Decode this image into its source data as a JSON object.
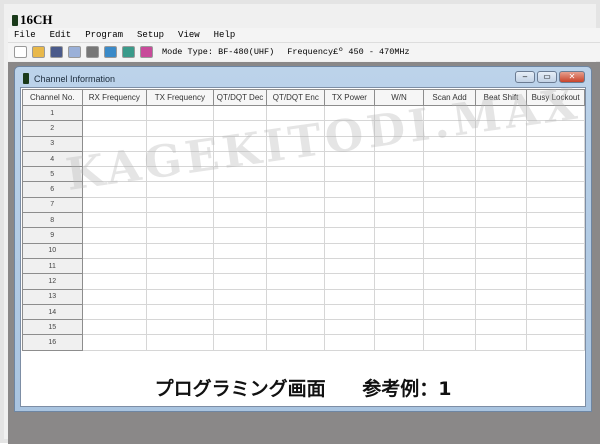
{
  "app": {
    "title": "16CH"
  },
  "menu": [
    "File",
    "Edit",
    "Program",
    "Setup",
    "View",
    "Help"
  ],
  "toolbar": {
    "icons": [
      "new-icon",
      "open-icon",
      "save-icon",
      "edit-icon",
      "print-icon",
      "read-icon",
      "write-icon",
      "eraser-icon"
    ],
    "mode_text": "Mode Type: BF-480(UHF)",
    "freq_text": "Frequency£º 450 - 470MHz"
  },
  "child": {
    "title": "Channel Information",
    "buttons": {
      "minimize": "–",
      "maximize": "▭",
      "close": "✕"
    }
  },
  "table": {
    "headers": [
      "Channel No.",
      "RX Frequency",
      "TX Frequency",
      "QT/DQT Dec",
      "QT/DQT Enc",
      "TX Power",
      "W/N",
      "Scan Add",
      "Beat Shift",
      "Busy Lockout"
    ],
    "rows": [
      "1",
      "2",
      "3",
      "4",
      "5",
      "6",
      "7",
      "8",
      "9",
      "10",
      "11",
      "12",
      "13",
      "14",
      "15",
      "16"
    ]
  },
  "caption": "プログラミング画面 参考例：1",
  "watermark": "KAGEKITODI.MAX",
  "colors": {
    "mdi_bg": "#8a8888",
    "child_frame": "#bcd3ea",
    "close_button": "#c8432a"
  }
}
